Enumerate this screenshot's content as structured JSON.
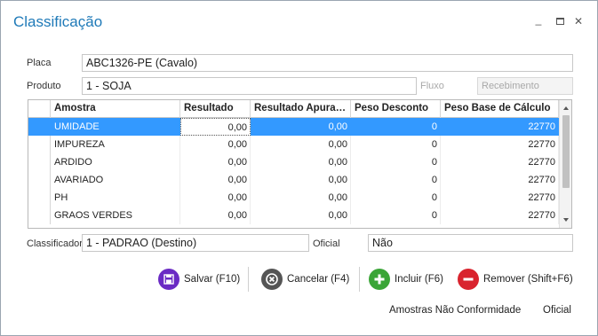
{
  "window": {
    "title": "Classificação",
    "minimize": "_",
    "maximize": "□",
    "close": "✕"
  },
  "form": {
    "placa_label": "Placa",
    "placa_value": "ABC1326-PE (Cavalo)",
    "produto_label": "Produto",
    "produto_value": "1 - SOJA",
    "fluxo_label": "Fluxo",
    "fluxo_value": "",
    "recebimento_value": "Recebimento",
    "classificador_label": "Classificador",
    "classificador_value": "1 - PADRAO (Destino)",
    "oficial_label": "Oficial",
    "oficial_value": "Não"
  },
  "grid": {
    "columns": [
      "Amostra",
      "Resultado",
      "Resultado Apura…",
      "Peso Desconto",
      "Peso Base de Cálculo"
    ],
    "rows": [
      {
        "amostra": "UMIDADE",
        "resultado": "0,00",
        "apurado": "0,00",
        "desconto": "0",
        "base": "22770"
      },
      {
        "amostra": "IMPUREZA",
        "resultado": "0,00",
        "apurado": "0,00",
        "desconto": "0",
        "base": "22770"
      },
      {
        "amostra": "ARDIDO",
        "resultado": "0,00",
        "apurado": "0,00",
        "desconto": "0",
        "base": "22770"
      },
      {
        "amostra": "AVARIADO",
        "resultado": "0,00",
        "apurado": "0,00",
        "desconto": "0",
        "base": "22770"
      },
      {
        "amostra": "PH",
        "resultado": "0,00",
        "apurado": "0,00",
        "desconto": "0",
        "base": "22770"
      },
      {
        "amostra": "GRAOS VERDES",
        "resultado": "0,00",
        "apurado": "0,00",
        "desconto": "0",
        "base": "22770"
      }
    ],
    "selected_row": 0
  },
  "actions": {
    "salvar": "Salvar (F10)",
    "cancelar": "Cancelar (F4)",
    "incluir": "Incluir (F6)",
    "remover": "Remover (Shift+F6)"
  },
  "footer": {
    "amostras_link": "Amostras Não Conformidade",
    "oficial_link": "Oficial"
  },
  "colors": {
    "title": "#1f7ab8",
    "selection": "#3399ff",
    "save_icon": "#6a2bc4",
    "cancel_icon": "#555555",
    "add_icon": "#3aa537",
    "remove_icon": "#d9232e"
  },
  "icons": {
    "salvar": "floppy-disk-icon",
    "cancelar": "x-circle-icon",
    "incluir": "plus-circle-icon",
    "remover": "minus-circle-icon"
  }
}
